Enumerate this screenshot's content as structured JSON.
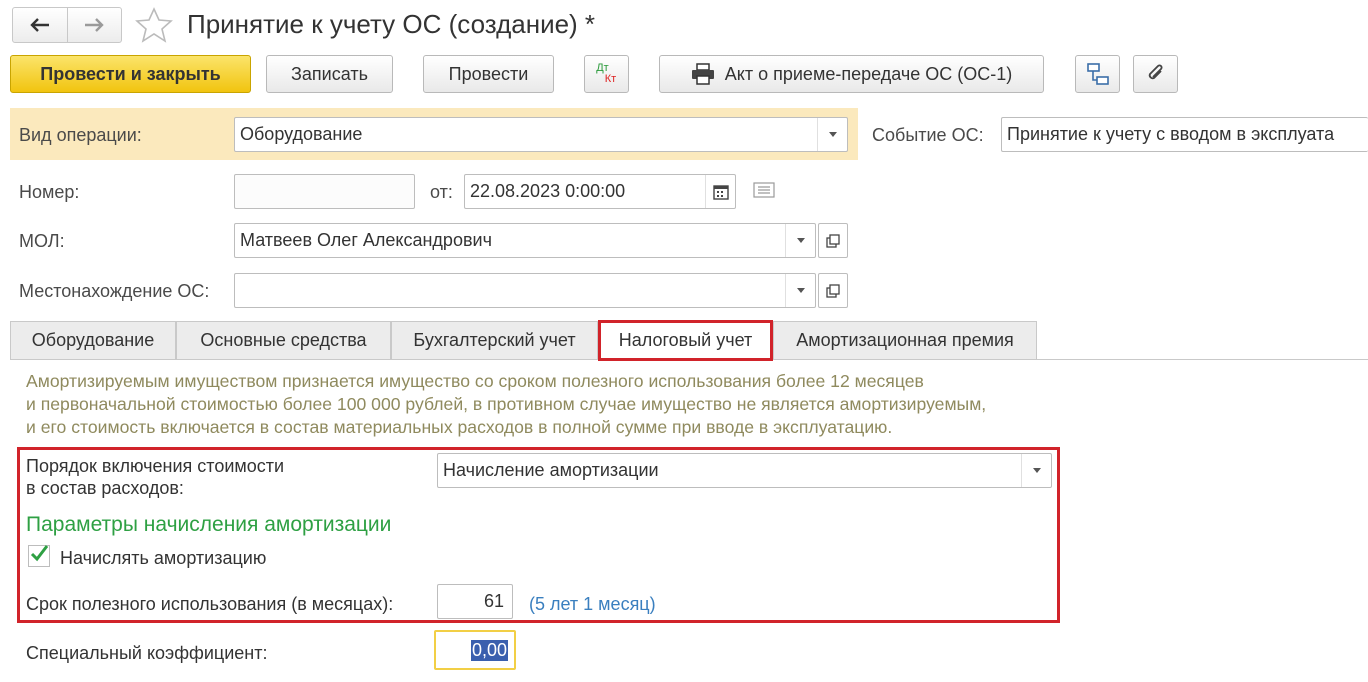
{
  "window": {
    "title": "Принятие к учету ОС (создание) *"
  },
  "toolbar": {
    "post_and_close": "Провести и закрыть",
    "save": "Записать",
    "post": "Провести",
    "dt_label": "Дт",
    "kt_label": "Кт",
    "print_label": "Акт о приеме-передаче ОС (ОС-1)"
  },
  "form": {
    "operation_type_label": "Вид операции:",
    "operation_type_value": "Оборудование",
    "asset_event_label": "Событие ОС:",
    "asset_event_value": "Принятие к учету с вводом в эксплуата",
    "number_label": "Номер:",
    "number_value": "",
    "date_label": "от:",
    "date_value": "22.08.2023  0:00:00",
    "mol_label": "МОЛ:",
    "mol_value": "Матвеев Олег Александрович",
    "location_label": "Местонахождение ОС:",
    "location_value": ""
  },
  "tabs": [
    {
      "label": "Оборудование",
      "active": false
    },
    {
      "label": "Основные средства",
      "active": false
    },
    {
      "label": "Бухгалтерский учет",
      "active": false
    },
    {
      "label": "Налоговый учет",
      "active": true
    },
    {
      "label": "Амортизационная премия",
      "active": false
    }
  ],
  "tax_tab": {
    "note_lines": [
      "Амортизируемым имуществом признается имущество со сроком полезного использования более 12 месяцев",
      "и первоначальной стоимостью более 100 000 рублей, в противном случае имущество не является амортизируемым,",
      "и его стоимость включается в состав материальных расходов в полной сумме при вводе в эксплуатацию."
    ],
    "cost_order_label_1": "Порядок включения стоимости",
    "cost_order_label_2": "в состав расходов:",
    "cost_order_value": "Начисление амортизации",
    "params_title": "Параметры начисления амортизации",
    "accrue_checkbox_label": "Начислять амортизацию",
    "accrue_checked": true,
    "useful_life_label": "Срок полезного использования (в месяцах):",
    "useful_life_value": "61",
    "useful_life_hint": "(5 лет 1 месяц)",
    "special_coef_label": "Специальный коэффициент:",
    "special_coef_value": "0,00"
  },
  "colors": {
    "primary_button": "#f1c40f",
    "operation_band": "#fbe9bd",
    "highlight_red": "#d1232a",
    "green_title": "#2ea043",
    "hint_blue": "#3a7fbf",
    "note_text": "#8f8a5e",
    "selection": "#3a5fae"
  },
  "icons": [
    "back-arrow-icon",
    "forward-arrow-icon",
    "favorite-star-icon",
    "dt-kt-icon",
    "printer-icon",
    "structure-icon",
    "paperclip-icon",
    "calendar-icon",
    "comment-icon",
    "dropdown-arrow-icon",
    "open-form-icon",
    "checkmark-icon"
  ]
}
